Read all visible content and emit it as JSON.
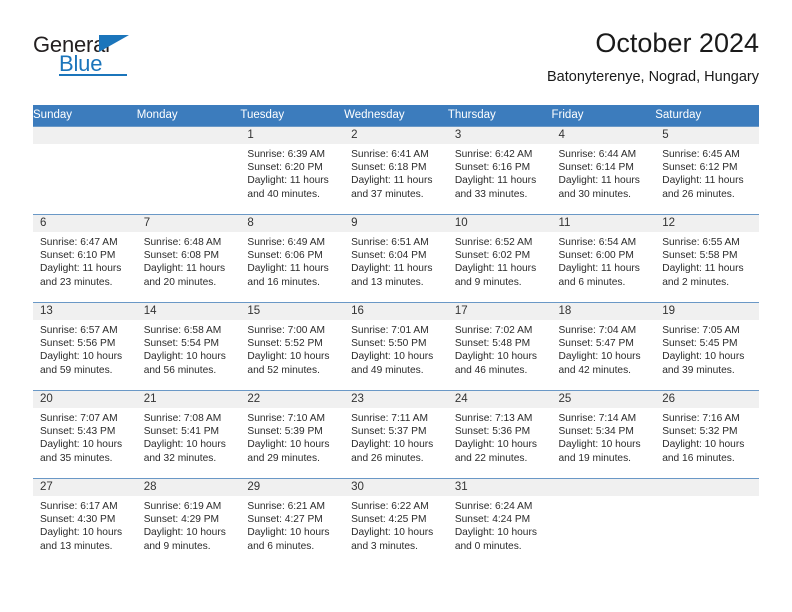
{
  "brand": {
    "name_top": "General",
    "name_bottom": "Blue",
    "accent_color": "#1b75bb",
    "logo_icon": "triangle-icon"
  },
  "header": {
    "title": "October 2024",
    "subtitle": "Batonyterenye, Nograd, Hungary"
  },
  "calendar": {
    "header_bg": "#3c7cbd",
    "daynum_band_bg": "#f0f0f0",
    "row_border_color": "#6a98c6",
    "weekday_headers": [
      "Sunday",
      "Monday",
      "Tuesday",
      "Wednesday",
      "Thursday",
      "Friday",
      "Saturday"
    ],
    "weeks": [
      [
        {
          "day": "",
          "blank": true,
          "sunrise": "",
          "sunset": "",
          "daylight_1": "",
          "daylight_2": ""
        },
        {
          "day": "",
          "blank": true,
          "sunrise": "",
          "sunset": "",
          "daylight_1": "",
          "daylight_2": ""
        },
        {
          "day": "1",
          "blank": false,
          "sunrise": "Sunrise: 6:39 AM",
          "sunset": "Sunset: 6:20 PM",
          "daylight_1": "Daylight: 11 hours",
          "daylight_2": "and 40 minutes."
        },
        {
          "day": "2",
          "blank": false,
          "sunrise": "Sunrise: 6:41 AM",
          "sunset": "Sunset: 6:18 PM",
          "daylight_1": "Daylight: 11 hours",
          "daylight_2": "and 37 minutes."
        },
        {
          "day": "3",
          "blank": false,
          "sunrise": "Sunrise: 6:42 AM",
          "sunset": "Sunset: 6:16 PM",
          "daylight_1": "Daylight: 11 hours",
          "daylight_2": "and 33 minutes."
        },
        {
          "day": "4",
          "blank": false,
          "sunrise": "Sunrise: 6:44 AM",
          "sunset": "Sunset: 6:14 PM",
          "daylight_1": "Daylight: 11 hours",
          "daylight_2": "and 30 minutes."
        },
        {
          "day": "5",
          "blank": false,
          "sunrise": "Sunrise: 6:45 AM",
          "sunset": "Sunset: 6:12 PM",
          "daylight_1": "Daylight: 11 hours",
          "daylight_2": "and 26 minutes."
        }
      ],
      [
        {
          "day": "6",
          "blank": false,
          "sunrise": "Sunrise: 6:47 AM",
          "sunset": "Sunset: 6:10 PM",
          "daylight_1": "Daylight: 11 hours",
          "daylight_2": "and 23 minutes."
        },
        {
          "day": "7",
          "blank": false,
          "sunrise": "Sunrise: 6:48 AM",
          "sunset": "Sunset: 6:08 PM",
          "daylight_1": "Daylight: 11 hours",
          "daylight_2": "and 20 minutes."
        },
        {
          "day": "8",
          "blank": false,
          "sunrise": "Sunrise: 6:49 AM",
          "sunset": "Sunset: 6:06 PM",
          "daylight_1": "Daylight: 11 hours",
          "daylight_2": "and 16 minutes."
        },
        {
          "day": "9",
          "blank": false,
          "sunrise": "Sunrise: 6:51 AM",
          "sunset": "Sunset: 6:04 PM",
          "daylight_1": "Daylight: 11 hours",
          "daylight_2": "and 13 minutes."
        },
        {
          "day": "10",
          "blank": false,
          "sunrise": "Sunrise: 6:52 AM",
          "sunset": "Sunset: 6:02 PM",
          "daylight_1": "Daylight: 11 hours",
          "daylight_2": "and 9 minutes."
        },
        {
          "day": "11",
          "blank": false,
          "sunrise": "Sunrise: 6:54 AM",
          "sunset": "Sunset: 6:00 PM",
          "daylight_1": "Daylight: 11 hours",
          "daylight_2": "and 6 minutes."
        },
        {
          "day": "12",
          "blank": false,
          "sunrise": "Sunrise: 6:55 AM",
          "sunset": "Sunset: 5:58 PM",
          "daylight_1": "Daylight: 11 hours",
          "daylight_2": "and 2 minutes."
        }
      ],
      [
        {
          "day": "13",
          "blank": false,
          "sunrise": "Sunrise: 6:57 AM",
          "sunset": "Sunset: 5:56 PM",
          "daylight_1": "Daylight: 10 hours",
          "daylight_2": "and 59 minutes."
        },
        {
          "day": "14",
          "blank": false,
          "sunrise": "Sunrise: 6:58 AM",
          "sunset": "Sunset: 5:54 PM",
          "daylight_1": "Daylight: 10 hours",
          "daylight_2": "and 56 minutes."
        },
        {
          "day": "15",
          "blank": false,
          "sunrise": "Sunrise: 7:00 AM",
          "sunset": "Sunset: 5:52 PM",
          "daylight_1": "Daylight: 10 hours",
          "daylight_2": "and 52 minutes."
        },
        {
          "day": "16",
          "blank": false,
          "sunrise": "Sunrise: 7:01 AM",
          "sunset": "Sunset: 5:50 PM",
          "daylight_1": "Daylight: 10 hours",
          "daylight_2": "and 49 minutes."
        },
        {
          "day": "17",
          "blank": false,
          "sunrise": "Sunrise: 7:02 AM",
          "sunset": "Sunset: 5:48 PM",
          "daylight_1": "Daylight: 10 hours",
          "daylight_2": "and 46 minutes."
        },
        {
          "day": "18",
          "blank": false,
          "sunrise": "Sunrise: 7:04 AM",
          "sunset": "Sunset: 5:47 PM",
          "daylight_1": "Daylight: 10 hours",
          "daylight_2": "and 42 minutes."
        },
        {
          "day": "19",
          "blank": false,
          "sunrise": "Sunrise: 7:05 AM",
          "sunset": "Sunset: 5:45 PM",
          "daylight_1": "Daylight: 10 hours",
          "daylight_2": "and 39 minutes."
        }
      ],
      [
        {
          "day": "20",
          "blank": false,
          "sunrise": "Sunrise: 7:07 AM",
          "sunset": "Sunset: 5:43 PM",
          "daylight_1": "Daylight: 10 hours",
          "daylight_2": "and 35 minutes."
        },
        {
          "day": "21",
          "blank": false,
          "sunrise": "Sunrise: 7:08 AM",
          "sunset": "Sunset: 5:41 PM",
          "daylight_1": "Daylight: 10 hours",
          "daylight_2": "and 32 minutes."
        },
        {
          "day": "22",
          "blank": false,
          "sunrise": "Sunrise: 7:10 AM",
          "sunset": "Sunset: 5:39 PM",
          "daylight_1": "Daylight: 10 hours",
          "daylight_2": "and 29 minutes."
        },
        {
          "day": "23",
          "blank": false,
          "sunrise": "Sunrise: 7:11 AM",
          "sunset": "Sunset: 5:37 PM",
          "daylight_1": "Daylight: 10 hours",
          "daylight_2": "and 26 minutes."
        },
        {
          "day": "24",
          "blank": false,
          "sunrise": "Sunrise: 7:13 AM",
          "sunset": "Sunset: 5:36 PM",
          "daylight_1": "Daylight: 10 hours",
          "daylight_2": "and 22 minutes."
        },
        {
          "day": "25",
          "blank": false,
          "sunrise": "Sunrise: 7:14 AM",
          "sunset": "Sunset: 5:34 PM",
          "daylight_1": "Daylight: 10 hours",
          "daylight_2": "and 19 minutes."
        },
        {
          "day": "26",
          "blank": false,
          "sunrise": "Sunrise: 7:16 AM",
          "sunset": "Sunset: 5:32 PM",
          "daylight_1": "Daylight: 10 hours",
          "daylight_2": "and 16 minutes."
        }
      ],
      [
        {
          "day": "27",
          "blank": false,
          "sunrise": "Sunrise: 6:17 AM",
          "sunset": "Sunset: 4:30 PM",
          "daylight_1": "Daylight: 10 hours",
          "daylight_2": "and 13 minutes."
        },
        {
          "day": "28",
          "blank": false,
          "sunrise": "Sunrise: 6:19 AM",
          "sunset": "Sunset: 4:29 PM",
          "daylight_1": "Daylight: 10 hours",
          "daylight_2": "and 9 minutes."
        },
        {
          "day": "29",
          "blank": false,
          "sunrise": "Sunrise: 6:21 AM",
          "sunset": "Sunset: 4:27 PM",
          "daylight_1": "Daylight: 10 hours",
          "daylight_2": "and 6 minutes."
        },
        {
          "day": "30",
          "blank": false,
          "sunrise": "Sunrise: 6:22 AM",
          "sunset": "Sunset: 4:25 PM",
          "daylight_1": "Daylight: 10 hours",
          "daylight_2": "and 3 minutes."
        },
        {
          "day": "31",
          "blank": false,
          "sunrise": "Sunrise: 6:24 AM",
          "sunset": "Sunset: 4:24 PM",
          "daylight_1": "Daylight: 10 hours",
          "daylight_2": "and 0 minutes."
        },
        {
          "day": "",
          "blank": true,
          "sunrise": "",
          "sunset": "",
          "daylight_1": "",
          "daylight_2": ""
        },
        {
          "day": "",
          "blank": true,
          "sunrise": "",
          "sunset": "",
          "daylight_1": "",
          "daylight_2": ""
        }
      ]
    ]
  }
}
